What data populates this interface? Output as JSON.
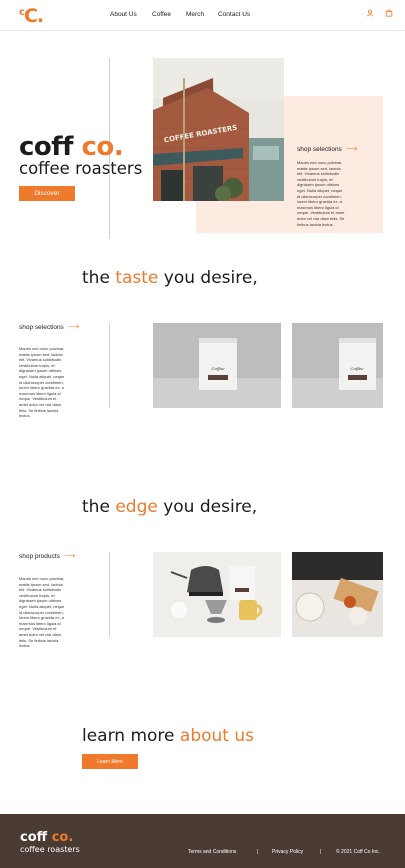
{
  "header": {
    "logo_big": "C.",
    "logo_small": "c",
    "nav": [
      "About Us",
      "Coffee",
      "Merch",
      "Contact Us"
    ],
    "icons": [
      "user-icon",
      "cart-icon"
    ]
  },
  "hero": {
    "title_main": "coff",
    "title_accent": "co.",
    "subtitle": "coffee roasters",
    "cta": "Discover",
    "storefront_sign": "COFFEE ROASTERS",
    "shop_link": "shop selections",
    "paragraph": "Mauris nec nunc pulvinar, mattis ipsum sed, lacinia elit. Vivamus sollicitudin vestibulum turpis, et dignissim ipsum ultrices eget. Nulla aliquet, neque id ullamcorper condimen, lorem libero gravida ex, a maximus libero ligula id neque. Vestibulum et amet dolor vel nisi diam felis. Se finibus lacinia lectus."
  },
  "section1": {
    "heading_pre": "the",
    "heading_accent": "taste",
    "heading_post": "you desire,",
    "link": "shop selections",
    "paragraph": "Mauris nec nunc pulvinar, mattis ipsum sed, lacinia elit. Vivamus sollicitudin vestibulum turpis, et dignissim ipsum ultrices eget. Nulla aliquet, neque id ullamcorper condimen, lorem libero gravida ex, a maximus libero ligula id neque. Vestibulum et amet dolor vel nisi diam felis. Se finibus lacinia lectus.",
    "bag_label": "Coffee"
  },
  "section2": {
    "heading_pre": "the",
    "heading_accent": "edge",
    "heading_post": "you desire,",
    "link": "shop products",
    "paragraph": "Mauris nec nunc pulvinar, mattis ipsum sed, lacinia elit. Vivamus sollicitudin vestibulum turpis, et dignissim ipsum ultrices eget. Nulla aliquet, neque id ullamcorper condimen, lorem libero gravida ex, a maximus libero ligula id neque. Vestibulum et amet dolor vel nisi diam felis. Se finibus lacinia lectus."
  },
  "about": {
    "heading_pre": "learn more",
    "heading_accent": "about us",
    "cta": "Learn More"
  },
  "footer": {
    "logo_main": "coff",
    "logo_accent": "co.",
    "subtitle": "coffee roasters",
    "links": [
      "Terms and Conditions",
      "Privacy Policy",
      "© 2021 Coff Co Inc."
    ],
    "separator": "|"
  },
  "colors": {
    "accent": "#f07a2c",
    "peach": "#fdebe1",
    "footer_bg": "#4a3b33"
  }
}
